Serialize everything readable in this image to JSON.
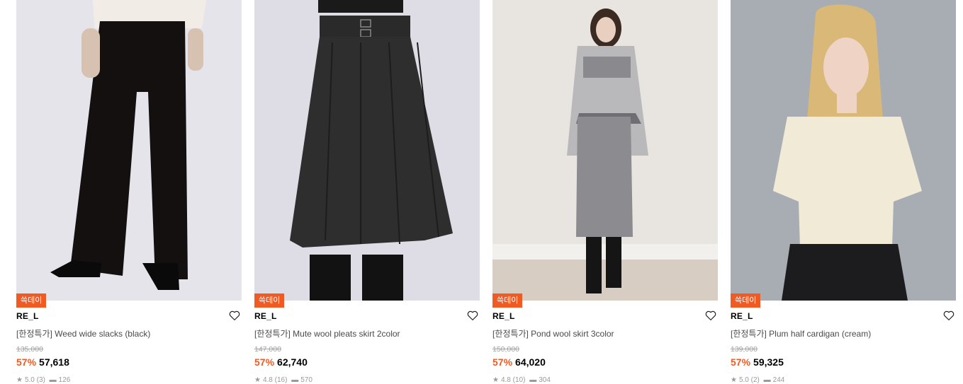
{
  "colors": {
    "accent": "#f05a23",
    "strike": "#a0a0a0"
  },
  "products": [
    {
      "badge": "쓱데이",
      "brand": "RE_L",
      "name": "[한정특가] Weed wide slacks (black)",
      "original_price": "135,000",
      "discount": "57%",
      "price": "57,618",
      "rating": "5.0 (3)",
      "reviews": "126",
      "image_alt": "black wide slacks photo"
    },
    {
      "badge": "쓱데이",
      "brand": "RE_L",
      "name": "[한정특가] Mute wool pleats skirt 2color",
      "original_price": "147,000",
      "discount": "57%",
      "price": "62,740",
      "rating": "4.8 (16)",
      "reviews": "570",
      "image_alt": "charcoal wool pleats skirt photo"
    },
    {
      "badge": "쓱데이",
      "brand": "RE_L",
      "name": "[한정특가] Pond wool skirt 3color",
      "original_price": "150,000",
      "discount": "57%",
      "price": "64,020",
      "rating": "4.8 (10)",
      "reviews": "304",
      "image_alt": "grey wool skirt photo"
    },
    {
      "badge": "쓱데이",
      "brand": "RE_L",
      "name": "[한정특가] Plum half cardigan (cream)",
      "original_price": "139,000",
      "discount": "57%",
      "price": "59,325",
      "rating": "5.0 (2)",
      "reviews": "244",
      "image_alt": "cream half cardigan photo"
    }
  ],
  "icons": {
    "wishlist": "heart-icon",
    "rating": "star-icon",
    "reviews": "comment-icon"
  }
}
